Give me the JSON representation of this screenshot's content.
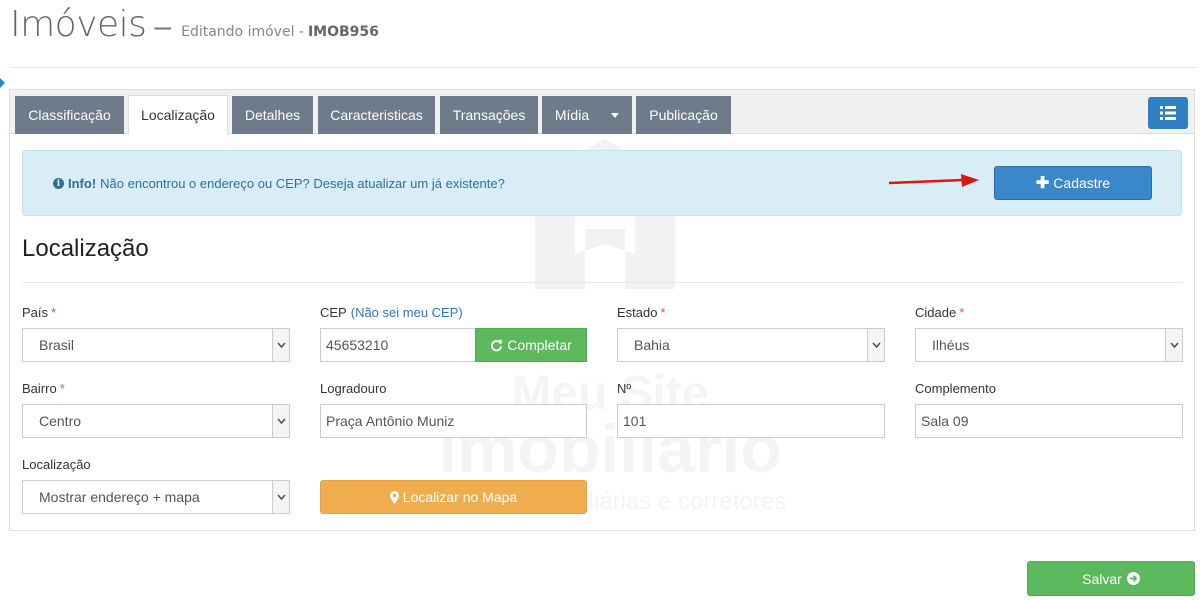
{
  "header": {
    "title": "Imóveis",
    "separator": "–",
    "subtitle": "Editando imóvel -",
    "code": "IMOB956"
  },
  "tabs": [
    {
      "label": "Classificação",
      "active": false
    },
    {
      "label": "Localização",
      "active": true
    },
    {
      "label": "Detalhes",
      "active": false
    },
    {
      "label": "Caracteristicas",
      "active": false
    },
    {
      "label": "Transações",
      "active": false
    },
    {
      "label": "Mídia",
      "active": false,
      "dropdown": true
    },
    {
      "label": "Publicação",
      "active": false
    }
  ],
  "toolbar": {
    "list_icon": "list-icon"
  },
  "watermark": {
    "line1": "Meu Site",
    "line2": "Imobiliário",
    "line3": "Site para mobiliárias e corretores"
  },
  "info": {
    "icon": "info-circle-icon",
    "strong": "Info!",
    "text": "Não encontrou o endereço ou CEP? Deseja atualizar um já existente?",
    "button_label": "Cadastre",
    "button_icon": "plus-icon"
  },
  "section": {
    "title": "Localização"
  },
  "form": {
    "pais": {
      "label": "País",
      "required": "*",
      "value": "Brasil"
    },
    "cep": {
      "label": "CEP",
      "help": "(Não sei meu CEP)",
      "value": "45653210",
      "button_label": "Completar",
      "button_icon": "refresh-icon"
    },
    "estado": {
      "label": "Estado",
      "required": "*",
      "value": "Bahia"
    },
    "cidade": {
      "label": "Cidade",
      "required": "*",
      "value": "Ilhéus"
    },
    "bairro": {
      "label": "Bairro",
      "required": "*",
      "value": "Centro"
    },
    "logradouro": {
      "label": "Logradouro",
      "value": "Praça Antônio Muniz"
    },
    "numero": {
      "label": "Nº",
      "value": "101"
    },
    "complemento": {
      "label": "Complemento",
      "value": "Sala 09"
    },
    "localizacao": {
      "label": "Localização",
      "value": "Mostrar endereço + mapa"
    },
    "localizar_button": {
      "label": "Localizar no Mapa",
      "icon": "map-marker-icon"
    }
  },
  "footer": {
    "save_label": "Salvar",
    "save_icon": "arrow-circle-right-icon"
  },
  "colors": {
    "tab_bg": "#6d7b8a",
    "primary": "#3b87cc",
    "success": "#5cb85c",
    "warning": "#f0ad4e",
    "info_bg": "#d9edf7",
    "info_text": "#31708f",
    "required": "#d9534f"
  }
}
